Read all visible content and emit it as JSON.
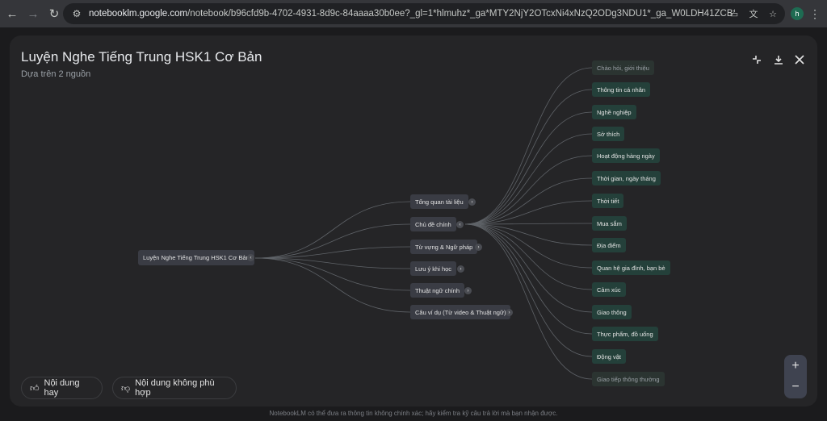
{
  "browser": {
    "url_host": "notebooklm.google.com",
    "url_path": "/notebook/b96cfd9b-4702-4931-8d9c-84aaaa30b0ee?_gl=1*hlmuhz*_ga*MTY2NjY2OTcxNi4xNzQ2ODg3NDU1*_ga_W0LDH41ZCB*czE3NDY4ODc0NTQkbzEkZzEkdD...",
    "profile_initial": "h"
  },
  "header": {
    "title": "Luyện Nghe Tiếng Trung HSK1 Cơ Bản",
    "subtitle": "Dựa trên 2 nguồn"
  },
  "mindmap": {
    "root": "Luyện Nghe Tiếng Trung HSK1 Cơ Bản",
    "branches": [
      "Tổng quan tài liệu",
      "Chủ đề chính",
      "Từ vựng & Ngữ pháp",
      "Lưu ý khi học",
      "Thuật ngữ chính",
      "Câu ví dụ (Từ video & Thuật ngữ)"
    ],
    "leaves": [
      "Chào hỏi, giới thiệu",
      "Thông tin cá nhân",
      "Nghề nghiệp",
      "Sở thích",
      "Hoạt động hàng ngày",
      "Thời gian, ngày tháng",
      "Thời tiết",
      "Mua sắm",
      "Địa điểm",
      "Quan hệ gia đình, bạn bè",
      "Cảm xúc",
      "Giao thông",
      "Thực phẩm, đồ uống",
      "Động vật",
      "Giao tiếp thông thường"
    ]
  },
  "feedback": {
    "good": "Nội dung hay",
    "bad": "Nội dung không phù hợp"
  },
  "zoom": {
    "in": "+",
    "out": "−"
  },
  "footer": {
    "disclaimer": "NotebookLM có thể đưa ra thông tin không chính xác; hãy kiểm tra kỹ câu trả lời mà bạn nhận được."
  },
  "colors": {
    "leaf_bg": "#24403a",
    "node_bg": "#3a3c44",
    "panel_bg": "#252527"
  }
}
